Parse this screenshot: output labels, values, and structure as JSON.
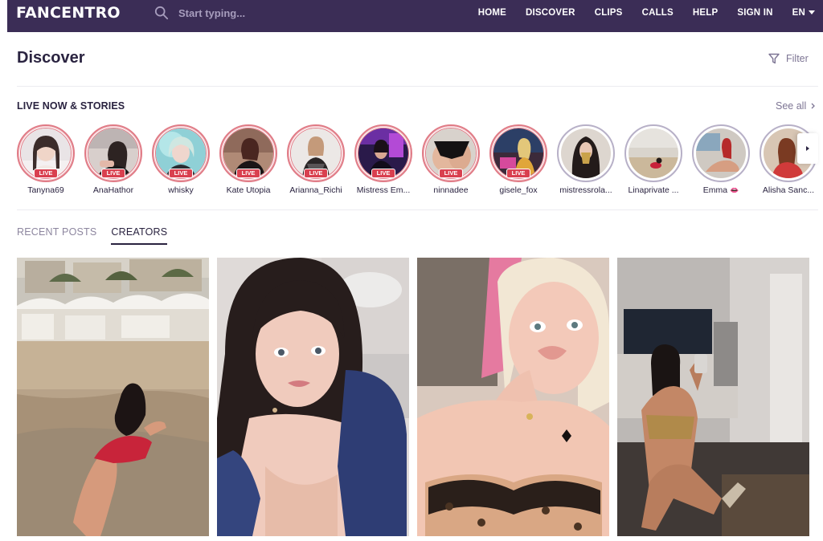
{
  "header": {
    "logo": "FANCENTRO",
    "search_placeholder": "Start typing...",
    "nav": [
      "HOME",
      "DISCOVER",
      "CLIPS",
      "CALLS",
      "HELP",
      "SIGN IN"
    ],
    "language": "EN",
    "background_color": "#3b2d56"
  },
  "page": {
    "title": "Discover",
    "filter_label": "Filter"
  },
  "live_section": {
    "heading": "LIVE NOW & STORIES",
    "see_all": "See all",
    "live_badge": "LIVE",
    "live_ring_color": "#e07b86",
    "badge_color": "#d9404f",
    "stories": [
      {
        "name": "Tanyna69",
        "live": true
      },
      {
        "name": "AnaHathor",
        "live": true
      },
      {
        "name": "whisky",
        "live": true
      },
      {
        "name": "Kate Utopia",
        "live": true
      },
      {
        "name": "Arianna_Richi",
        "live": true
      },
      {
        "name": "Mistress Em...",
        "live": true
      },
      {
        "name": "ninnadee",
        "live": true
      },
      {
        "name": "gisele_fox",
        "live": true
      },
      {
        "name": "mistressrola...",
        "live": false
      },
      {
        "name": "Linaprivate ...",
        "live": false
      },
      {
        "name": "Emma",
        "live": false,
        "emoji": "lips-icon"
      },
      {
        "name": "Alisha Sanc...",
        "live": false
      }
    ]
  },
  "tabs": [
    {
      "label": "RECENT POSTS",
      "active": false
    },
    {
      "label": "CREATORS",
      "active": true
    }
  ],
  "creator_cards": [
    {
      "image": "creator-photo-beach"
    },
    {
      "image": "creator-photo-dark-hair"
    },
    {
      "image": "creator-photo-blonde"
    },
    {
      "image": "creator-photo-mirror-selfie"
    }
  ]
}
